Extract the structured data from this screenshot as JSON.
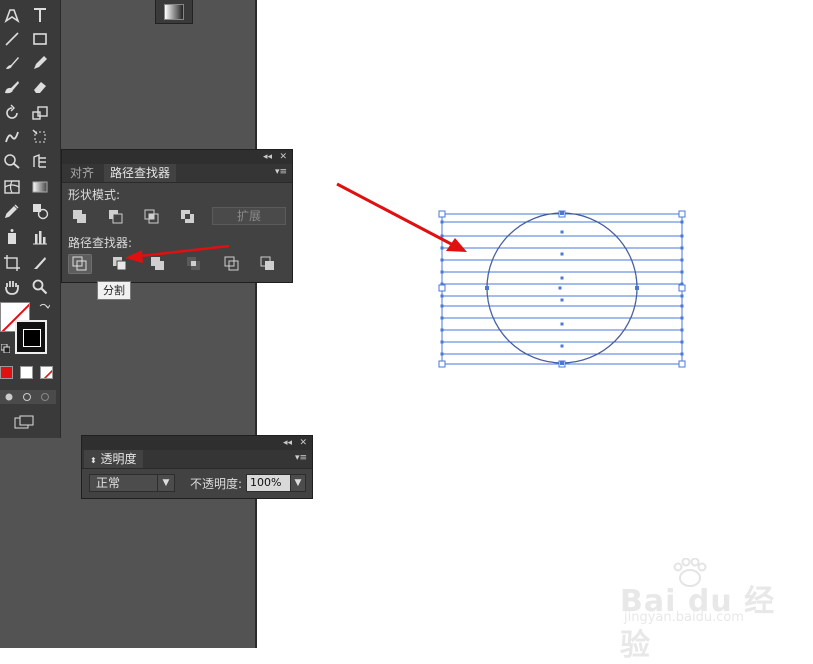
{
  "pathfinder_panel": {
    "tabs": [
      {
        "label": "对齐",
        "active": false
      },
      {
        "label": "路径查找器",
        "active": true
      }
    ],
    "shape_modes_label": "形状模式:",
    "expand_label": "扩展",
    "pathfinders_label": "路径查找器:",
    "shape_mode_buttons": [
      "unite-icon",
      "minus-front-icon",
      "intersect-icon",
      "exclude-icon"
    ],
    "pathfinder_buttons": [
      "divide-icon",
      "trim-icon",
      "merge-icon",
      "crop-icon",
      "outline-icon",
      "minus-back-icon"
    ],
    "tooltip": "分割"
  },
  "transparency_panel": {
    "tab_label": "透明度",
    "blend_mode": "正常",
    "opacity_label": "不透明度:",
    "opacity_value": "100%"
  },
  "toolbar": {
    "icons": [
      "pen-icon",
      "type-icon",
      "line-icon",
      "rectangle-icon",
      "paintbrush-icon",
      "pencil-icon",
      "blob-brush-icon",
      "eraser-icon",
      "rotate-icon",
      "scale-icon",
      "warp-icon",
      "free-transform-icon",
      "shape-builder-icon",
      "perspective-grid-icon",
      "mesh-icon",
      "gradient-icon",
      "eyedropper-icon",
      "blend-icon",
      "symbol-sprayer-icon",
      "column-graph-icon",
      "artboard-icon",
      "slice-icon",
      "hand-icon",
      "zoom-icon"
    ]
  },
  "colors": {
    "selection_blue": "#4a78d8",
    "arrow_red": "#e01010",
    "panel_bg": "#424242"
  },
  "watermark": {
    "brand": "Bai du 经验",
    "url": "jingyan.baidu.com"
  }
}
